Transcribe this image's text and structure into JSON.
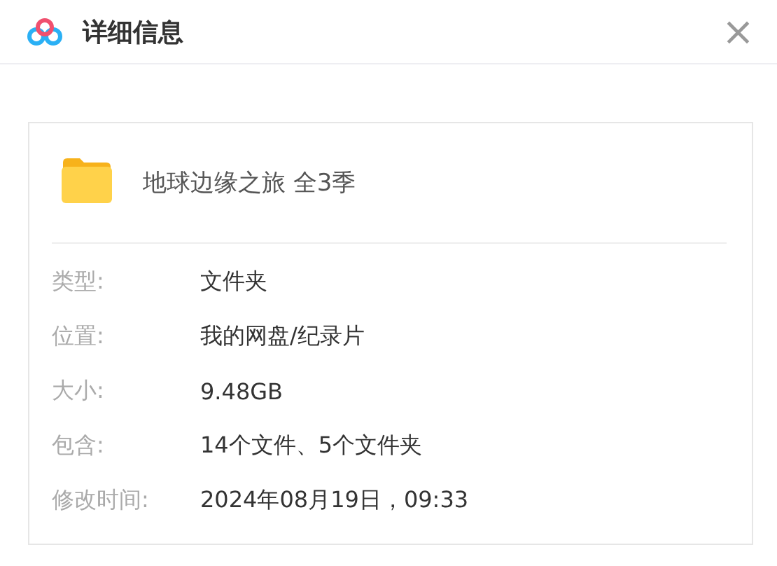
{
  "window": {
    "title": "详细信息",
    "close": "×"
  },
  "file": {
    "name": "地球边缘之旅 全3季"
  },
  "details": [
    {
      "label": "类型:",
      "value": "文件夹"
    },
    {
      "label": "位置:",
      "value": "我的网盘/纪录片"
    },
    {
      "label": "大小:",
      "value": "9.48GB"
    },
    {
      "label": "包含:",
      "value": "14个文件、5个文件夹"
    },
    {
      "label": "修改时间:",
      "value": "2024年08月19日，09:33"
    }
  ]
}
